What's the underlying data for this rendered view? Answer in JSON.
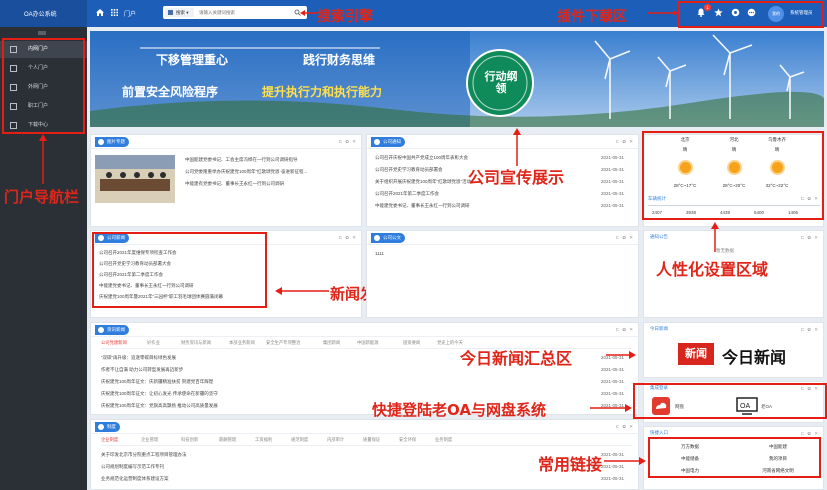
{
  "app": {
    "title": "OA办公系统"
  },
  "topbar": {
    "breadcrumb": "门户",
    "search_type": "搜索",
    "search_placeholder": "请输入关键词搜索",
    "notification_count": "1",
    "user_avatar": "我的",
    "user_name": "系统管理员"
  },
  "sidebar": {
    "items": [
      {
        "label": "内网门户",
        "active": true
      },
      {
        "label": "个人门户",
        "active": false
      },
      {
        "label": "外网门户",
        "active": false
      },
      {
        "label": "职工门户",
        "active": false
      },
      {
        "label": "下载中心",
        "active": false
      }
    ]
  },
  "banner": {
    "line1": "下移管理重心",
    "line2": "践行财务思维",
    "line3": "前置安全风险程序",
    "line4": "提升执行力和执行能力",
    "badge": "行动纲领"
  },
  "annotations": {
    "search": "搜索引擎",
    "plugin": "插件下载区",
    "nav": "门户导航栏",
    "promo": "公司宣传展示",
    "personal": "人性化设置区域",
    "news_pub": "新闻发布与展示区",
    "today_news": "今日新闻汇总区",
    "quick_login": "快捷登陆老OA与网盘系统",
    "links": "常用链接"
  },
  "panels": {
    "photo_news": {
      "title": "图片专题",
      "items": [
        "中国能建党委书记、工会主席冯桦在一行到公司调研指导",
        "公司党委隆重举办庆祝建党100周年“红歌颂党恩·奋进新征程...",
        "中能建有党委书记、董事长王永红一行到公司调研"
      ]
    },
    "company_notice": {
      "title": "公司通知",
      "items": [
        {
          "text": "公司召开庆祝中国共产党成立100周年表彰大会",
          "date": "2021-05-31"
        },
        {
          "text": "公司召开党史学习教育动员部署会",
          "date": "2021-05-31"
        },
        {
          "text": "关于组织开展庆祝建党100周年“红歌颂党恩”活动",
          "date": "2021-05-31"
        },
        {
          "text": "公司召开2021年第二季度工作会",
          "date": "2021-05-31"
        },
        {
          "text": "中能建党委书记、董事长王永红一行到公司调研",
          "date": "2021-05-31"
        }
      ]
    },
    "weather": {
      "cities": [
        {
          "name": "北京",
          "cond": "晴",
          "temp": "28°C~17°C"
        },
        {
          "name": "河北",
          "cond": "晴",
          "temp": "28°C~20°C"
        },
        {
          "name": "乌鲁木齐",
          "cond": "晴",
          "temp": "32°C~22°C"
        }
      ]
    },
    "stats": {
      "title": "车辆统计",
      "values": [
        "2407",
        "3938",
        "4439",
        "5400",
        "1406"
      ]
    },
    "notice_announce": {
      "title": "通知公告",
      "empty": "暂无数据"
    },
    "company_news": {
      "title": "公司新闻",
      "items": [
        "公司召开2021年度维保专项检查工作会",
        "公司召开党史学习教育动员部署大会",
        "公司召开2021年第二季度工作会",
        "中能建党委书记、董事长王永红一行到公司调研",
        "庆祝建党100周年暨2021年“三园杯”职工羽毛球团体赛圆满闭幕"
      ]
    },
    "company_doc": {
      "title": "公司公文",
      "item": "1111"
    },
    "today_news_panel": {
      "title": "今日新闻",
      "logo_red": "新闻",
      "logo_text": "今日新闻"
    },
    "info_news": {
      "title": "资讯新闻",
      "tabs": [
        "公司党建新闻",
        "好作业",
        "财务资讯与新闻",
        "本部业务新闻",
        "安全生产专项整治",
        "集团新闻",
        "中国新能源",
        "国资要闻",
        "党史上的今天"
      ],
      "items": [
        {
          "text": "“双碳”再升级：追逐零碳目标绿色发展",
          "date": "2021-05-31"
        },
        {
          "text": "作者不让自满 助力公司转型发展再迈新步",
          "date": "2021-05-31"
        },
        {
          "text": "庆祝建党100周年征文：庆新疆精准扶贫 贺建党百年辉煌",
          "date": "2021-05-31"
        },
        {
          "text": "庆祝建党100周年征文：让初心发光 传承使命在新疆的坚守",
          "date": "2021-05-31"
        },
        {
          "text": "庆祝建党100周年征文：党旗高高飘扬 推动公司高质量发展",
          "date": "2021-05-31"
        }
      ]
    },
    "quick_login": {
      "title": "集成登录",
      "items": [
        {
          "label": "网盘"
        },
        {
          "label": "老OA"
        }
      ]
    },
    "policy": {
      "title": "制度",
      "tabs": [
        "企业制度",
        "企业管理",
        "科技创新",
        "薪酬管理",
        "工资福利",
        "规范制度",
        "内部审计",
        "质量保证",
        "安全环保",
        "业务制度"
      ],
      "items": [
        {
          "text": "关于印发北京市分院重点工程项目管理办法",
          "date": "2021-05-31"
        },
        {
          "text": "公司规划制度编写示范工作专刊",
          "date": "2021-05-31"
        },
        {
          "text": "业务规范化运营制度体系建设方案",
          "date": "2021-05-31"
        }
      ]
    },
    "quick_links": {
      "title": "快捷入口",
      "links": [
        "万方数据",
        "中国能建",
        "中能储备",
        "我的项目",
        "中国电力",
        "河南省网络文明"
      ]
    }
  },
  "colors": {
    "brand": "#1d5fb8",
    "sidebar": "#2b2f36",
    "accent_red": "#e41e14"
  }
}
